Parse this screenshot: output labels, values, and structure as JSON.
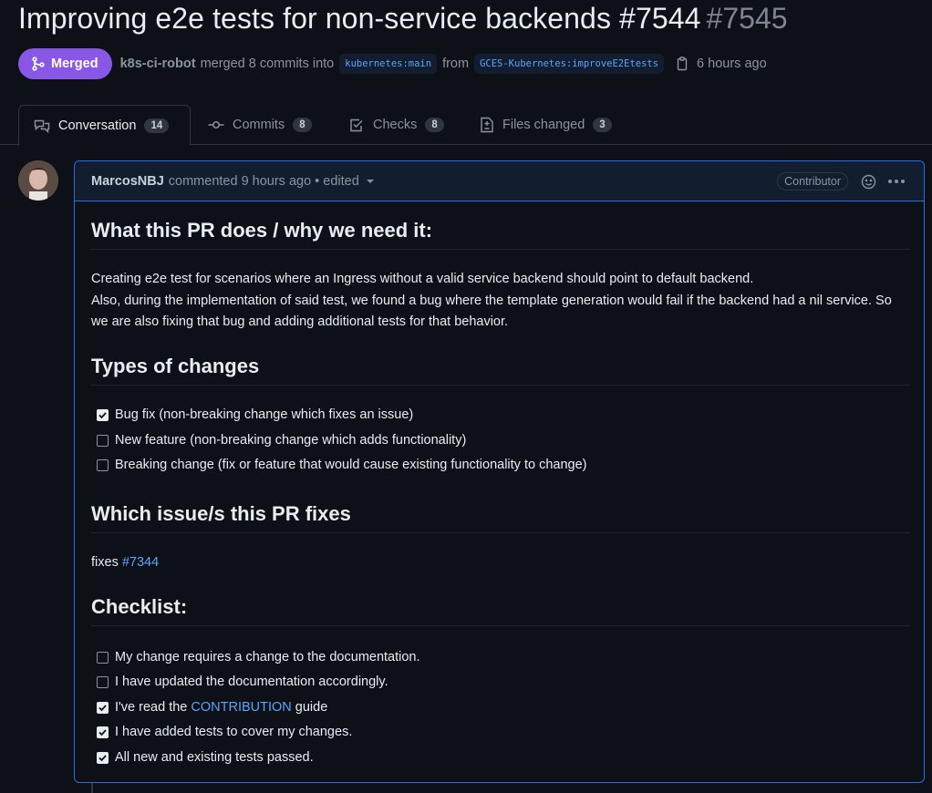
{
  "pr": {
    "title": "Improving e2e tests for non-service backends #7544",
    "number": "#7545",
    "status": "Merged",
    "merge_author": "k8s-ci-robot",
    "merge_text": "merged 8 commits into",
    "base_branch": "kubernetes:main",
    "from_text": "from",
    "head_branch": "GCES-Kubernetes:improveE2Etests",
    "time": "6 hours ago"
  },
  "tabs": [
    {
      "label": "Conversation",
      "count": "14",
      "icon": "conversation-icon"
    },
    {
      "label": "Commits",
      "count": "8",
      "icon": "commit-icon"
    },
    {
      "label": "Checks",
      "count": "8",
      "icon": "checks-icon"
    },
    {
      "label": "Files changed",
      "count": "3",
      "icon": "file-diff-icon"
    }
  ],
  "comment": {
    "author": "MarcosNBJ",
    "meta": "commented 9 hours ago • edited",
    "role": "Contributor",
    "sections": {
      "what_heading": "What this PR does / why we need it:",
      "what_p1": "Creating e2e test for scenarios where an Ingress without a valid service backend should point to default backend.",
      "what_p2": "Also, during the implementation of said test, we found a bug where the template generation would fail if the backend had a nil service. So we are also fixing that bug and adding additional tests for that behavior.",
      "types_heading": "Types of changes",
      "types": [
        {
          "label": "Bug fix (non-breaking change which fixes an issue)",
          "checked": true
        },
        {
          "label": "New feature (non-breaking change which adds functionality)",
          "checked": false
        },
        {
          "label": "Breaking change (fix or feature that would cause existing functionality to change)",
          "checked": false
        }
      ],
      "issue_heading": "Which issue/s this PR fixes",
      "issue_prefix": "fixes",
      "issue_link": "#7344",
      "checklist_heading": "Checklist:",
      "checklist": [
        {
          "label": "My change requires a change to the documentation.",
          "checked": false
        },
        {
          "label": "I have updated the documentation accordingly.",
          "checked": false
        },
        {
          "label_before": "I've read the",
          "link": "CONTRIBUTION",
          "label_after": "guide",
          "checked": true
        },
        {
          "label": "I have added tests to cover my changes.",
          "checked": true
        },
        {
          "label": "All new and existing tests passed.",
          "checked": true
        }
      ]
    }
  },
  "colors": {
    "merged": "#8957e5",
    "link": "#58a6ff",
    "accent_border": "#1f6feb",
    "background": "#0d1117"
  }
}
